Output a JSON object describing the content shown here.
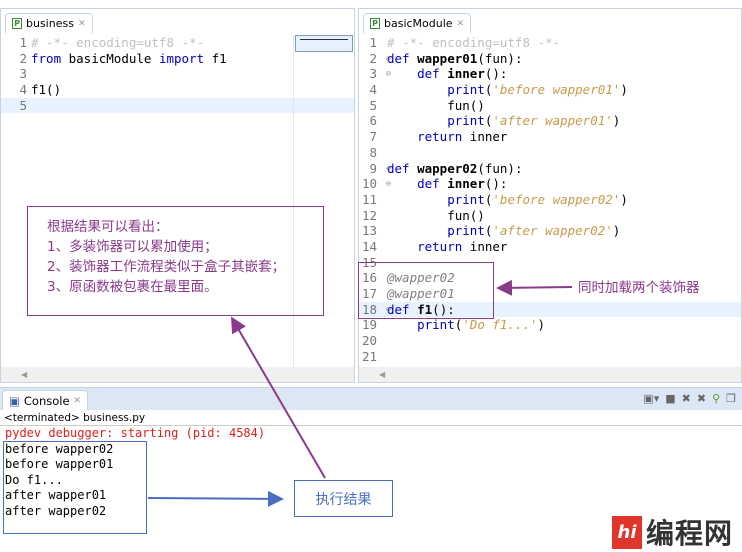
{
  "left_editor": {
    "tab_label": "business",
    "lines": [
      [
        [
          "# -*- encoding=utf8 -*-",
          "comment"
        ]
      ],
      [
        [
          "from",
          "kw"
        ],
        [
          " basicModule ",
          "plain"
        ],
        [
          "import",
          "kw"
        ],
        [
          " f1",
          "plain"
        ]
      ],
      [],
      [
        [
          "f1()",
          "plain"
        ]
      ],
      []
    ]
  },
  "right_editor": {
    "tab_label": "basicModule",
    "lines": [
      [
        [
          "# -*- encoding=utf8 -*-",
          "comment"
        ]
      ],
      [
        [
          "def",
          "kw"
        ],
        [
          " ",
          "plain"
        ],
        [
          "wapper01",
          "fn"
        ],
        [
          "(fun):",
          "plain"
        ]
      ],
      [
        [
          "    def",
          "kw"
        ],
        [
          " ",
          "plain"
        ],
        [
          "inner",
          "fn"
        ],
        [
          "():",
          "plain"
        ]
      ],
      [
        [
          "        print",
          "kw"
        ],
        [
          "(",
          "plain"
        ],
        [
          "'before wapper01'",
          "str"
        ],
        [
          ")",
          "plain"
        ]
      ],
      [
        [
          "        fun()",
          "plain"
        ]
      ],
      [
        [
          "        print",
          "kw"
        ],
        [
          "(",
          "plain"
        ],
        [
          "'after wapper01'",
          "str"
        ],
        [
          ")",
          "plain"
        ]
      ],
      [
        [
          "    return",
          "kw"
        ],
        [
          " inner",
          "plain"
        ]
      ],
      [],
      [
        [
          "def",
          "kw"
        ],
        [
          " ",
          "plain"
        ],
        [
          "wapper02",
          "fn"
        ],
        [
          "(fun):",
          "plain"
        ]
      ],
      [
        [
          "    def",
          "kw"
        ],
        [
          " ",
          "plain"
        ],
        [
          "inner",
          "fn"
        ],
        [
          "():",
          "plain"
        ]
      ],
      [
        [
          "        print",
          "kw"
        ],
        [
          "(",
          "plain"
        ],
        [
          "'before wapper02'",
          "str"
        ],
        [
          ")",
          "plain"
        ]
      ],
      [
        [
          "        fun()",
          "plain"
        ]
      ],
      [
        [
          "        print",
          "kw"
        ],
        [
          "(",
          "plain"
        ],
        [
          "'after wapper02'",
          "str"
        ],
        [
          ")",
          "plain"
        ]
      ],
      [
        [
          "    return",
          "kw"
        ],
        [
          " inner",
          "plain"
        ]
      ],
      [],
      [
        [
          "@wapper02",
          "dec"
        ]
      ],
      [
        [
          "@wapper01",
          "dec"
        ]
      ],
      [
        [
          "def",
          "kw"
        ],
        [
          " ",
          "plain"
        ],
        [
          "f1",
          "fn"
        ],
        [
          "():",
          "plain"
        ]
      ],
      [
        [
          "    print",
          "kw"
        ],
        [
          "(",
          "plain"
        ],
        [
          "'Do f1...'",
          "str"
        ],
        [
          ")",
          "plain"
        ]
      ],
      [],
      []
    ],
    "fold_lines": [
      2,
      3,
      9,
      10,
      18
    ],
    "current_line": 18
  },
  "console": {
    "tab_label": "Console",
    "status": "<terminated> business.py",
    "error_line": "pydev debugger: starting (pid: 4584)",
    "output": [
      "before wapper02",
      "before wapper01",
      "Do f1...",
      "after wapper01",
      "after wapper02"
    ]
  },
  "annotations": {
    "note_lines": [
      "根据结果可以看出：",
      "1、多装饰器可以累加使用；",
      "2、装饰器工作流程类似于盒子其嵌套；",
      "3、原函数被包裹在最里面。"
    ],
    "decorator_label": "同时加载两个装饰器",
    "result_label": "执行结果"
  },
  "watermark": {
    "mark": "hi",
    "text": "编程网"
  },
  "colors": {
    "annotation": "#8b3a8b",
    "result_arrow": "#4a6fc0",
    "error": "#e02020"
  }
}
